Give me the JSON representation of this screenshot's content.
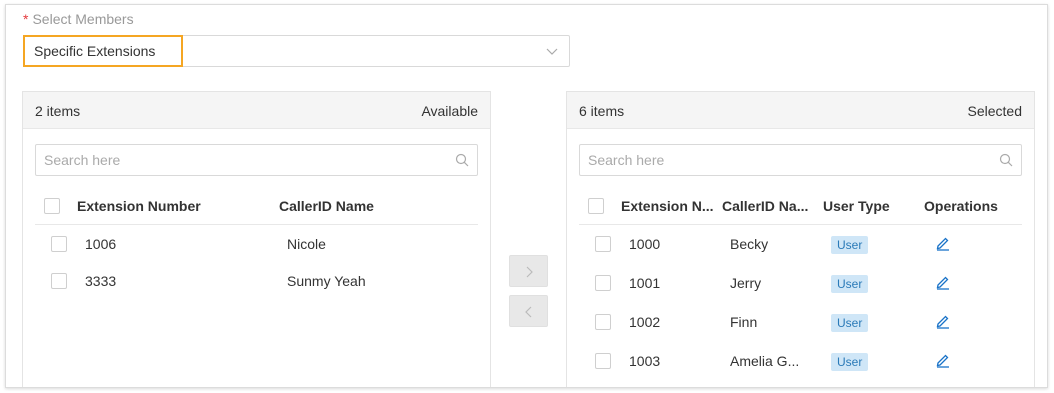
{
  "field": {
    "required_mark": "*",
    "label": "Select Members",
    "selected_value": "Specific Extensions"
  },
  "available": {
    "count": "2 items",
    "title": "Available",
    "search_placeholder": "Search here",
    "headers": [
      "Extension Number",
      "CallerID Name"
    ],
    "rows": [
      {
        "ext": "1006",
        "name": "Nicole"
      },
      {
        "ext": "3333",
        "name": "Sunmy Yeah"
      }
    ]
  },
  "selected": {
    "count": "6 items",
    "title": "Selected",
    "search_placeholder": "Search here",
    "headers": [
      "Extension N...",
      "CallerID Na...",
      "User Type",
      "Operations"
    ],
    "rows": [
      {
        "ext": "1000",
        "name": "Becky",
        "type": "User"
      },
      {
        "ext": "1001",
        "name": "Jerry",
        "type": "User"
      },
      {
        "ext": "1002",
        "name": "Finn",
        "type": "User"
      },
      {
        "ext": "1003",
        "name": "Amelia G...",
        "type": "User"
      }
    ]
  },
  "icons": {
    "dropdown": "chevron-down-icon",
    "search": "search-icon",
    "move_right": "chevron-right-icon",
    "move_left": "chevron-left-icon",
    "edit": "edit-pencil-icon"
  },
  "colors": {
    "highlight": "#f5a623",
    "badge_bg": "#cfe6f7",
    "badge_text": "#2a7ab8",
    "edit_icon": "#1a73c8",
    "required": "#e4393c"
  }
}
